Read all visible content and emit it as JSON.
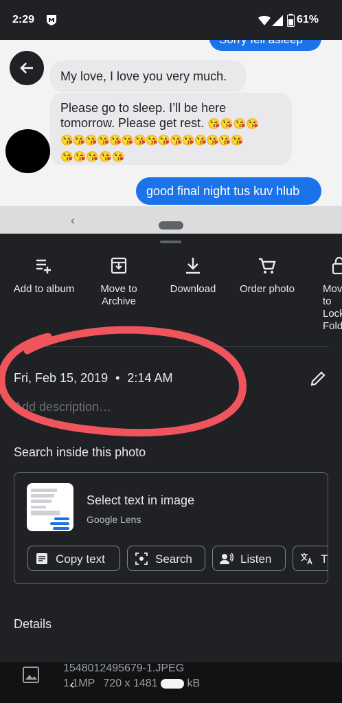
{
  "status_bar": {
    "time": "2:29",
    "battery": "61%"
  },
  "photo": {
    "top_bubble_text": "Sorry fell asleep",
    "message1": "My love, I love you very much.",
    "message2_text": "Please go to sleep. I’ll be here tomorrow. Please get rest.",
    "message2_emoji_line1": "😘😘😘😘",
    "message2_emoji_line2": "😘😘😘😘😘😘😘😘😘😘😘😘😘😘😘",
    "message2_emoji_line3": "😘😘😘😘😘",
    "reply": "good final night tus kuv hlub"
  },
  "actions": [
    {
      "label": "Add to album",
      "icon": "add-to-album-icon"
    },
    {
      "label": "Move to Archive",
      "icon": "archive-icon"
    },
    {
      "label": "Download",
      "icon": "download-icon"
    },
    {
      "label": "Order photo",
      "icon": "cart-icon"
    },
    {
      "label": "Move to Locked Folder",
      "icon": "lock-icon"
    }
  ],
  "info": {
    "date": "Fri, Feb 15, 2019",
    "separator": "•",
    "time": "2:14 AM",
    "description_placeholder": "Add description…"
  },
  "search_section": {
    "title": "Search inside this photo",
    "lens_title": "Select text in image",
    "lens_subtitle": "Google Lens",
    "chips": [
      "Copy text",
      "Search",
      "Listen",
      "Translate"
    ]
  },
  "details": {
    "title": "Details",
    "filename": "1548012495679-1.JPEG",
    "megapixels": "1.1MP",
    "resolution": "720 x 1481",
    "size_unit": "kB"
  },
  "colors": {
    "accent": "#1a73e8",
    "circle": "#f0555d"
  }
}
